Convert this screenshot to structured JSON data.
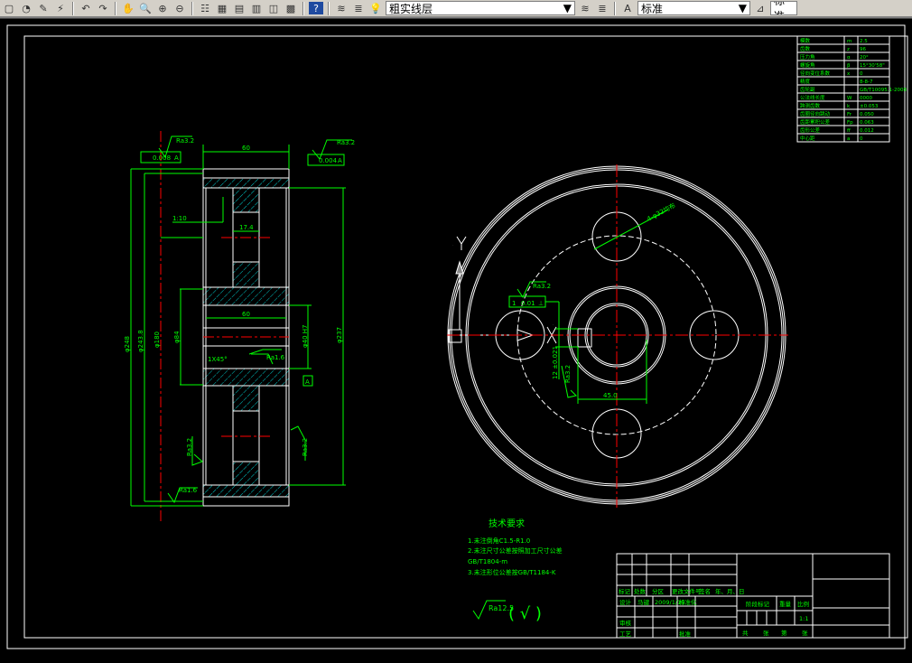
{
  "toolbar": {
    "icons": [
      "new-icon",
      "open-icon",
      "brush-icon",
      "match-properties-icon",
      "undo-icon",
      "redo-icon",
      "pan-icon",
      "zoom-realtime-icon",
      "zoom-window-icon",
      "zoom-previous-icon",
      "properties-icon",
      "design-center-icon",
      "tool-palette-icon",
      "sheet-set-icon",
      "markup-icon",
      "calculator-icon",
      "help-icon",
      "layer-manager-icon",
      "layer-state-icon"
    ],
    "layer_value": "粗实线层",
    "text_style_value": "标准",
    "dim_style_value": "标准",
    "help_glyph": "?"
  },
  "drawing": {
    "colors": {
      "background": "#000000",
      "outline": "#ffffff",
      "dimension": "#00ff00",
      "centerline": "#ff0000",
      "hatch": "#00ffff"
    },
    "left_view": {
      "width_dim": "60",
      "tol_left": "0.008",
      "tol_left_ref": "A",
      "tol_right": "0.004",
      "tol_right_ref": "A",
      "ra_top_left": "Ra3.2",
      "ra_top_right": "Ra3.2",
      "taper": "1:10",
      "web_dim": "17.4",
      "bore_len": "60",
      "chamfer": "1X45°",
      "ra_bore": "Ra1.6",
      "datum": "A",
      "ra_right": "Ra3.2",
      "ra_left": "Ra3.2",
      "ra_bottom": "Ra1.6",
      "dia_outer": "φ248",
      "dia_tip": "φ243.8",
      "dia_root": "φ180",
      "dia_hub": "φ84",
      "dia_bore": "φ40 H7",
      "dia_right": "φ237"
    },
    "right_view": {
      "hole_dim": "4-φ32均布",
      "tol_ref": "0.01",
      "ra": "Ra3.2",
      "key_depth": "12 ±0.021",
      "ra_key": "Ra3.2",
      "key_width": "45.0",
      "ucs_y": "Y",
      "ucs_x": "X"
    },
    "param_table": [
      [
        "模数",
        "m",
        "2.5"
      ],
      [
        "齿数",
        "z",
        "96"
      ],
      [
        "压力角",
        "α",
        "20°"
      ],
      [
        "螺旋角",
        "β",
        "15°30'58\""
      ],
      [
        "径向变位系数",
        "x",
        "0"
      ],
      [
        "精度",
        "",
        "8-8-7"
      ],
      [
        "齿轮副",
        "",
        "GB/T10095.1-2008"
      ],
      [
        "公法线长度",
        "W",
        "0000"
      ],
      [
        "跨测齿数",
        "k",
        "±0.053"
      ],
      [
        "齿圈径向跳动",
        "Fr",
        "0.050"
      ],
      [
        "齿距累积公差",
        "Fp",
        "0.063"
      ],
      [
        "齿形公差",
        "ff",
        "0.012"
      ],
      [
        "中心距",
        "a",
        "0"
      ]
    ],
    "tech_req": {
      "title": "技术要求",
      "items": [
        "1.未注倒角C1.5-R1.0",
        "2.未注尺寸公差按照加工尺寸公差",
        "GB/T1804-m",
        "3.未注形位公差按GB/T1184-K"
      ],
      "roughness": "Ra12.5",
      "roughness_paren": "( √ )"
    },
    "title_block": {
      "header": [
        "标记",
        "处数",
        "分区",
        "更改文件号",
        "签名",
        "年、月、日"
      ],
      "design": "设计",
      "designer": "马键",
      "date_sig": "2009/1/10",
      "standard": "标准化",
      "stage": "阶段标记",
      "weight": "重量",
      "scale_label": "比例",
      "scale": "1:1",
      "review": "审核",
      "process": "工艺",
      "approve": "批准",
      "sheets": [
        "共",
        "张",
        "第",
        "张"
      ]
    }
  }
}
